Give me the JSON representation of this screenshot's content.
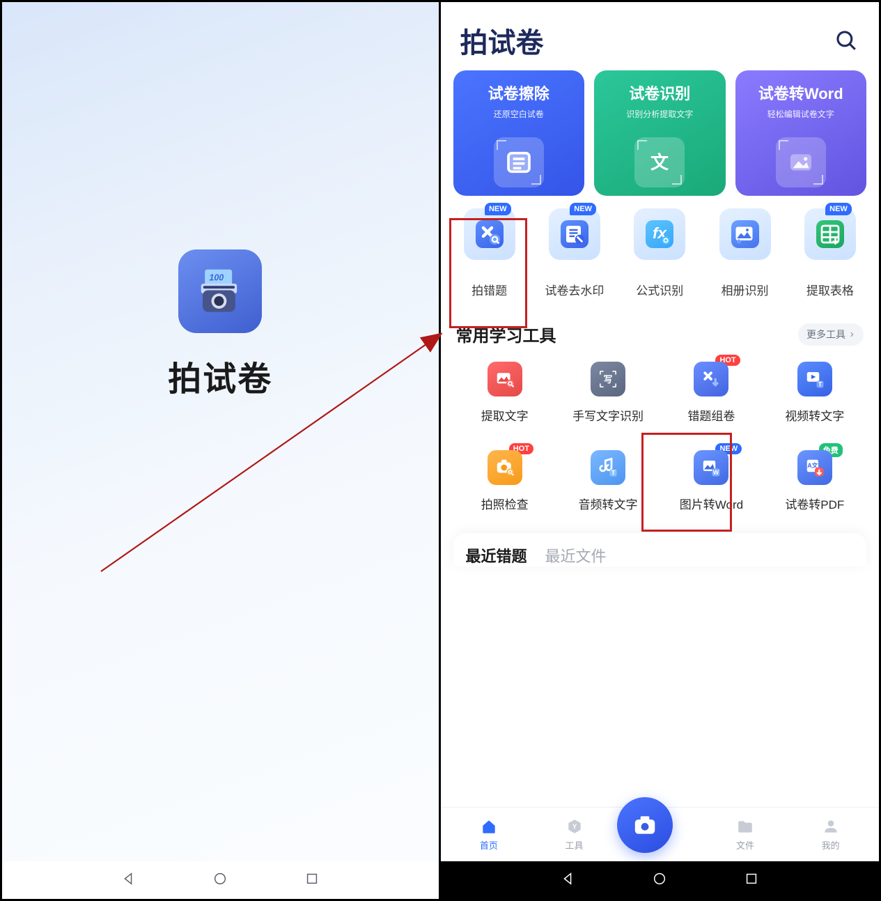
{
  "splash": {
    "title": "拍试卷"
  },
  "header": {
    "title": "拍试卷"
  },
  "features": [
    {
      "title": "试卷擦除",
      "subtitle": "还原空白试卷"
    },
    {
      "title": "试卷识别",
      "subtitle": "识别分析提取文字"
    },
    {
      "title": "试卷转Word",
      "subtitle": "轻松编辑试卷文字"
    }
  ],
  "tools": [
    {
      "label": "拍错题",
      "badge": "NEW"
    },
    {
      "label": "试卷去水印",
      "badge": "NEW"
    },
    {
      "label": "公式识别"
    },
    {
      "label": "相册识别"
    },
    {
      "label": "提取表格",
      "badge": "NEW"
    }
  ],
  "section": {
    "title": "常用学习工具",
    "more": "更多工具"
  },
  "learn": [
    {
      "label": "提取文字"
    },
    {
      "label": "手写文字识别"
    },
    {
      "label": "错题组卷",
      "badge": "HOT",
      "badge_color": "#ff4040"
    },
    {
      "label": "视频转文字"
    },
    {
      "label": "拍照检查",
      "badge": "HOT",
      "badge_color": "#ff4040"
    },
    {
      "label": "音频转文字"
    },
    {
      "label": "图片转Word",
      "badge": "NEW",
      "badge_color": "#2f6cff"
    },
    {
      "label": "试卷转PDF",
      "badge": "免费",
      "badge_color": "#22c17a"
    }
  ],
  "recent": {
    "tab1": "最近错题",
    "tab2": "最近文件"
  },
  "nav": {
    "home": "首页",
    "tools": "工具",
    "files": "文件",
    "me": "我的"
  }
}
